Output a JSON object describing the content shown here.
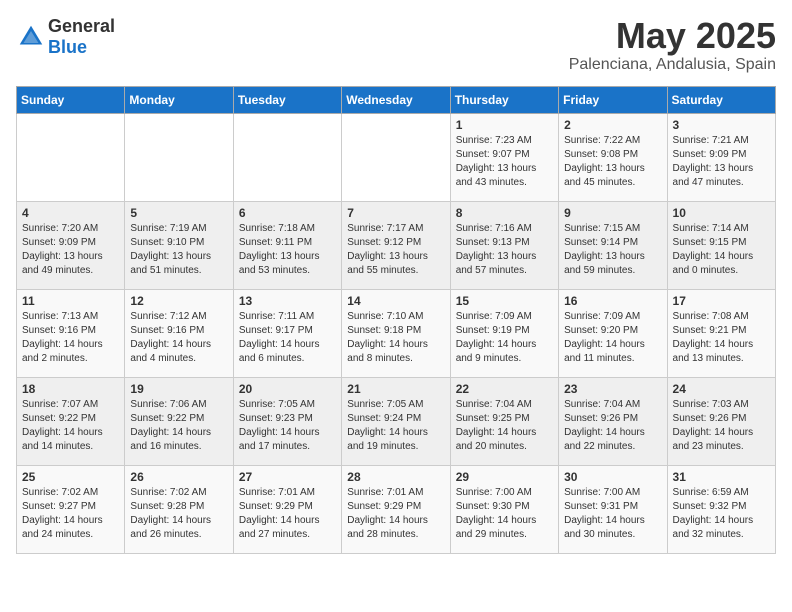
{
  "logo": {
    "general": "General",
    "blue": "Blue"
  },
  "title": "May 2025",
  "location": "Palenciana, Andalusia, Spain",
  "headers": [
    "Sunday",
    "Monday",
    "Tuesday",
    "Wednesday",
    "Thursday",
    "Friday",
    "Saturday"
  ],
  "weeks": [
    [
      {
        "day": "",
        "info": ""
      },
      {
        "day": "",
        "info": ""
      },
      {
        "day": "",
        "info": ""
      },
      {
        "day": "",
        "info": ""
      },
      {
        "day": "1",
        "info": "Sunrise: 7:23 AM\nSunset: 9:07 PM\nDaylight: 13 hours\nand 43 minutes."
      },
      {
        "day": "2",
        "info": "Sunrise: 7:22 AM\nSunset: 9:08 PM\nDaylight: 13 hours\nand 45 minutes."
      },
      {
        "day": "3",
        "info": "Sunrise: 7:21 AM\nSunset: 9:09 PM\nDaylight: 13 hours\nand 47 minutes."
      }
    ],
    [
      {
        "day": "4",
        "info": "Sunrise: 7:20 AM\nSunset: 9:09 PM\nDaylight: 13 hours\nand 49 minutes."
      },
      {
        "day": "5",
        "info": "Sunrise: 7:19 AM\nSunset: 9:10 PM\nDaylight: 13 hours\nand 51 minutes."
      },
      {
        "day": "6",
        "info": "Sunrise: 7:18 AM\nSunset: 9:11 PM\nDaylight: 13 hours\nand 53 minutes."
      },
      {
        "day": "7",
        "info": "Sunrise: 7:17 AM\nSunset: 9:12 PM\nDaylight: 13 hours\nand 55 minutes."
      },
      {
        "day": "8",
        "info": "Sunrise: 7:16 AM\nSunset: 9:13 PM\nDaylight: 13 hours\nand 57 minutes."
      },
      {
        "day": "9",
        "info": "Sunrise: 7:15 AM\nSunset: 9:14 PM\nDaylight: 13 hours\nand 59 minutes."
      },
      {
        "day": "10",
        "info": "Sunrise: 7:14 AM\nSunset: 9:15 PM\nDaylight: 14 hours\nand 0 minutes."
      }
    ],
    [
      {
        "day": "11",
        "info": "Sunrise: 7:13 AM\nSunset: 9:16 PM\nDaylight: 14 hours\nand 2 minutes."
      },
      {
        "day": "12",
        "info": "Sunrise: 7:12 AM\nSunset: 9:16 PM\nDaylight: 14 hours\nand 4 minutes."
      },
      {
        "day": "13",
        "info": "Sunrise: 7:11 AM\nSunset: 9:17 PM\nDaylight: 14 hours\nand 6 minutes."
      },
      {
        "day": "14",
        "info": "Sunrise: 7:10 AM\nSunset: 9:18 PM\nDaylight: 14 hours\nand 8 minutes."
      },
      {
        "day": "15",
        "info": "Sunrise: 7:09 AM\nSunset: 9:19 PM\nDaylight: 14 hours\nand 9 minutes."
      },
      {
        "day": "16",
        "info": "Sunrise: 7:09 AM\nSunset: 9:20 PM\nDaylight: 14 hours\nand 11 minutes."
      },
      {
        "day": "17",
        "info": "Sunrise: 7:08 AM\nSunset: 9:21 PM\nDaylight: 14 hours\nand 13 minutes."
      }
    ],
    [
      {
        "day": "18",
        "info": "Sunrise: 7:07 AM\nSunset: 9:22 PM\nDaylight: 14 hours\nand 14 minutes."
      },
      {
        "day": "19",
        "info": "Sunrise: 7:06 AM\nSunset: 9:22 PM\nDaylight: 14 hours\nand 16 minutes."
      },
      {
        "day": "20",
        "info": "Sunrise: 7:05 AM\nSunset: 9:23 PM\nDaylight: 14 hours\nand 17 minutes."
      },
      {
        "day": "21",
        "info": "Sunrise: 7:05 AM\nSunset: 9:24 PM\nDaylight: 14 hours\nand 19 minutes."
      },
      {
        "day": "22",
        "info": "Sunrise: 7:04 AM\nSunset: 9:25 PM\nDaylight: 14 hours\nand 20 minutes."
      },
      {
        "day": "23",
        "info": "Sunrise: 7:04 AM\nSunset: 9:26 PM\nDaylight: 14 hours\nand 22 minutes."
      },
      {
        "day": "24",
        "info": "Sunrise: 7:03 AM\nSunset: 9:26 PM\nDaylight: 14 hours\nand 23 minutes."
      }
    ],
    [
      {
        "day": "25",
        "info": "Sunrise: 7:02 AM\nSunset: 9:27 PM\nDaylight: 14 hours\nand 24 minutes."
      },
      {
        "day": "26",
        "info": "Sunrise: 7:02 AM\nSunset: 9:28 PM\nDaylight: 14 hours\nand 26 minutes."
      },
      {
        "day": "27",
        "info": "Sunrise: 7:01 AM\nSunset: 9:29 PM\nDaylight: 14 hours\nand 27 minutes."
      },
      {
        "day": "28",
        "info": "Sunrise: 7:01 AM\nSunset: 9:29 PM\nDaylight: 14 hours\nand 28 minutes."
      },
      {
        "day": "29",
        "info": "Sunrise: 7:00 AM\nSunset: 9:30 PM\nDaylight: 14 hours\nand 29 minutes."
      },
      {
        "day": "30",
        "info": "Sunrise: 7:00 AM\nSunset: 9:31 PM\nDaylight: 14 hours\nand 30 minutes."
      },
      {
        "day": "31",
        "info": "Sunrise: 6:59 AM\nSunset: 9:32 PM\nDaylight: 14 hours\nand 32 minutes."
      }
    ]
  ]
}
